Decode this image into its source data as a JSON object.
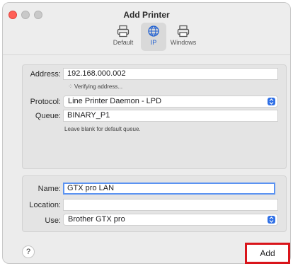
{
  "window": {
    "title": "Add Printer"
  },
  "toolbar": {
    "items": [
      {
        "label": "Default",
        "icon": "printer-icon"
      },
      {
        "label": "IP",
        "icon": "globe-icon"
      },
      {
        "label": "Windows",
        "icon": "printer-icon"
      }
    ],
    "selected": "IP"
  },
  "form": {
    "address": {
      "label": "Address:",
      "value": "192.168.000.002"
    },
    "status": "Verifying address...",
    "protocol": {
      "label": "Protocol:",
      "value": "Line Printer Daemon - LPD"
    },
    "queue": {
      "label": "Queue:",
      "value": "BINARY_P1",
      "hint": "Leave blank for default queue."
    },
    "name": {
      "label": "Name:",
      "value": "GTX pro LAN"
    },
    "location": {
      "label": "Location:",
      "value": ""
    },
    "use": {
      "label": "Use:",
      "value": "Brother GTX pro"
    }
  },
  "footer": {
    "help_label": "?",
    "add_label": "Add"
  },
  "colors": {
    "accent": "#2e6fe6",
    "highlight": "#d9141a"
  }
}
